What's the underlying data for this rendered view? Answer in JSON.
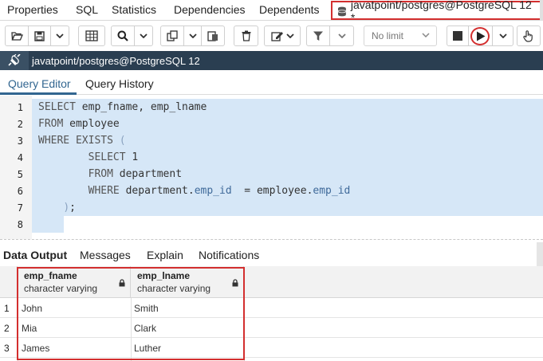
{
  "top_tabs": {
    "items": [
      "Properties",
      "SQL",
      "Statistics",
      "Dependencies",
      "Dependents"
    ],
    "active": "javatpoint/postgres@PostgreSQL 12 *"
  },
  "toolbar": {
    "limit_label": "No limit"
  },
  "connection": {
    "label": "javatpoint/postgres@PostgreSQL 12"
  },
  "query_tabs": {
    "editor": "Query Editor",
    "history": "Query History"
  },
  "editor": {
    "lines": [
      {
        "n": "1",
        "tokens": [
          [
            "kw",
            "SELECT "
          ],
          [
            "t",
            "emp_fname, emp_lname"
          ]
        ]
      },
      {
        "n": "2",
        "tokens": [
          [
            "kw",
            "FROM "
          ],
          [
            "t",
            "employee"
          ]
        ]
      },
      {
        "n": "3",
        "tokens": [
          [
            "kw",
            "WHERE EXISTS "
          ],
          [
            "paren",
            "("
          ]
        ]
      },
      {
        "n": "4",
        "tokens": [
          [
            "t",
            "        "
          ],
          [
            "kw",
            "SELECT "
          ],
          [
            "num",
            "1"
          ]
        ]
      },
      {
        "n": "5",
        "tokens": [
          [
            "t",
            "        "
          ],
          [
            "kw",
            "FROM "
          ],
          [
            "t",
            "department"
          ]
        ]
      },
      {
        "n": "6",
        "tokens": [
          [
            "t",
            "        "
          ],
          [
            "kw",
            "WHERE "
          ],
          [
            "t",
            "department."
          ],
          [
            "col",
            "emp_id"
          ],
          [
            "t",
            "  = employee."
          ],
          [
            "col",
            "emp_id"
          ]
        ]
      },
      {
        "n": "7",
        "tokens": [
          [
            "t",
            "    "
          ],
          [
            "paren",
            ")"
          ],
          [
            "t",
            ";"
          ]
        ]
      },
      {
        "n": "8",
        "tokens": []
      }
    ]
  },
  "output_tabs": {
    "items": [
      "Data Output",
      "Messages",
      "Explain",
      "Notifications"
    ],
    "active": "Data Output"
  },
  "result": {
    "columns": [
      {
        "name": "emp_fname",
        "type": "character varying"
      },
      {
        "name": "emp_lname",
        "type": "character varying"
      }
    ],
    "rows": [
      {
        "n": "1",
        "cells": [
          "John",
          "Smith"
        ]
      },
      {
        "n": "2",
        "cells": [
          "Mia",
          "Clark"
        ]
      },
      {
        "n": "3",
        "cells": [
          "James",
          "Luther"
        ]
      }
    ]
  },
  "colors": {
    "highlight_red": "#d32f2f",
    "connection_bar": "#2a3e51",
    "selection": "#d6e7f7",
    "accent_blue": "#326690"
  }
}
